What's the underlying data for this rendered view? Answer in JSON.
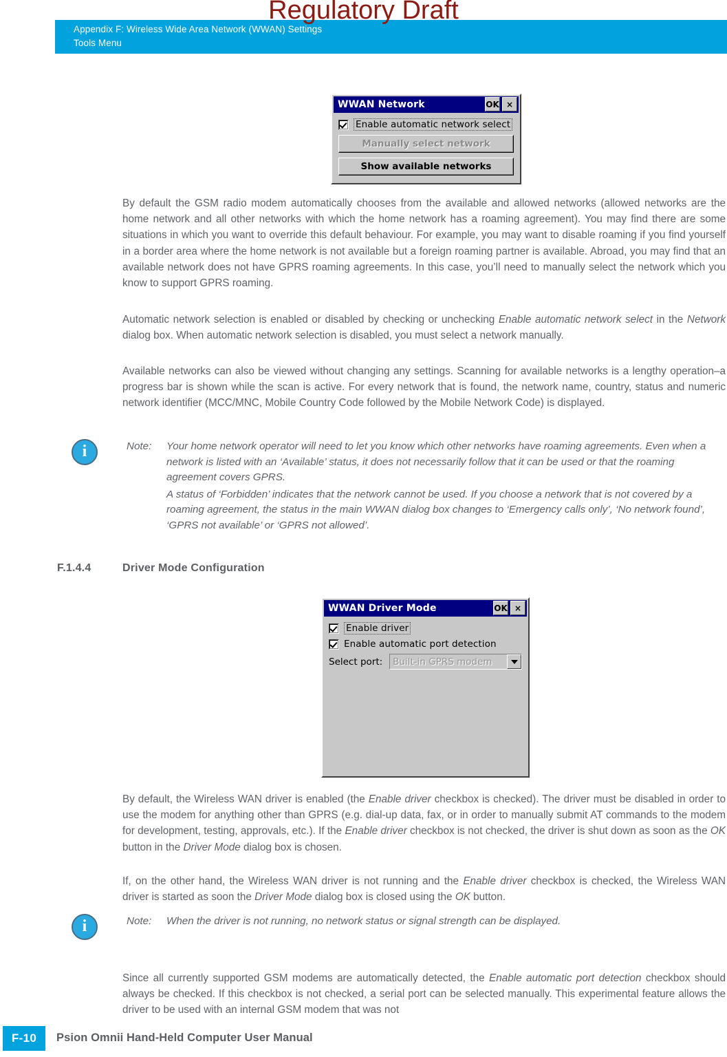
{
  "watermark": "Regulatory Draft",
  "header": {
    "line1": "Appendix F: Wireless Wide Area Network (WWAN) Settings",
    "line2": "Tools Menu",
    "band_color": "#00A3DD"
  },
  "dialog_network": {
    "title": "WWAN Network",
    "ok_label": "OK",
    "close_label": "×",
    "checkbox": {
      "label": "Enable automatic network select",
      "checked": true
    },
    "buttons": [
      {
        "label": "Manually select network",
        "disabled": true
      },
      {
        "label": "Show available networks",
        "disabled": false
      }
    ]
  },
  "paragraphs": {
    "p1": "By default the GSM radio modem automatically chooses from the available and allowed networks (allowed networks are the home network and all other networks with which the home network has a roaming agreement). You may find there are some situations in which you want to override this default behaviour. For example, you may want to disable roaming if you find yourself in a border area where the home network is not available but a foreign roaming partner is available. Abroad, you may find that an available network does not have GPRS roaming agreements. In this case, you’ll need to manually select the network which you know to support GPRS roaming.",
    "p2_a": "Automatic network selection is enabled or disabled by checking or unchecking ",
    "p2_i1": "Enable automatic network select",
    "p2_b": " in the ",
    "p2_i2": "Network",
    "p2_c": " dialog box. When automatic network selection is disabled, you must select a network manually.",
    "p3": "Available networks can also be viewed without changing any settings. Scanning for available networks is a lengthy operation–a progress bar is shown while the scan is active. For every network that is found, the network name, country, status and numeric network identifier (MCC/MNC, Mobile Country Code followed by the Mobile Network Code) is displayed."
  },
  "note1": {
    "tag": "Note:",
    "icon": "info-icon",
    "text1": "Your home network operator will need to let you know which other networks have roaming agreements. Even when a network is listed with an ‘Available’ status, it does not necessarily follow that it can be used or that the roaming agreement covers GPRS.",
    "text2": "A status of ‘Forbidden’ indicates that the network cannot be used. If you choose a network that is not covered by a roaming agreement, the status in the main WWAN dialog box changes to ‘Emergency calls only’, ‘No network found’, ‘GPRS not available’ or ‘GPRS not allowed’."
  },
  "section": {
    "number": "F.1.4.4",
    "title": "Driver Mode Configuration"
  },
  "dialog_driver": {
    "title": "WWAN Driver Mode",
    "ok_label": "OK",
    "close_label": "×",
    "checkbox1": {
      "label": "Enable driver",
      "checked": true
    },
    "checkbox2": {
      "label": "Enable automatic port detection",
      "checked": true
    },
    "port": {
      "label": "Select port:",
      "value": "Built-in GPRS modem",
      "disabled": true
    }
  },
  "paragraphs2": {
    "p4_a": "By default, the Wireless WAN driver is enabled (the ",
    "p4_i1": "Enable driver",
    "p4_b": " checkbox is checked). The driver must be disabled in order to use the modem for anything other than GPRS (e.g. dial-up data, fax, or in order to manually submit AT commands to the modem for development, testing, approvals, etc.). If the ",
    "p4_i2": "Enable driver",
    "p4_c": " checkbox is not checked, the driver is shut down as soon as the ",
    "p4_i3": "OK",
    "p4_d": " button in the ",
    "p4_i4": "Driver Mode",
    "p4_e": " dialog box is chosen.",
    "p5_a": "If, on the other hand, the Wireless WAN driver is not running and the ",
    "p5_i1": "Enable driver",
    "p5_b": " checkbox is checked, the Wireless WAN driver is started as soon the ",
    "p5_i2": "Driver Mode",
    "p5_c": " dialog box is closed using the ",
    "p5_i3": "OK",
    "p5_d": " button.",
    "p6_a": "Since all currently supported GSM modems are automatically detected, the ",
    "p6_i1": "Enable automatic port detection",
    "p6_b": " checkbox should always be checked. If this checkbox is not checked, a serial port can be selected manually. This experimental feature allows the driver to be used with an internal GSM modem that was not"
  },
  "note2": {
    "tag": "Note:",
    "icon": "info-icon",
    "text1": "When the driver is not running, no network status or signal strength can be displayed."
  },
  "footer": {
    "page": "F-10",
    "title": "Psion Omnii Hand-Held Computer User Manual"
  }
}
